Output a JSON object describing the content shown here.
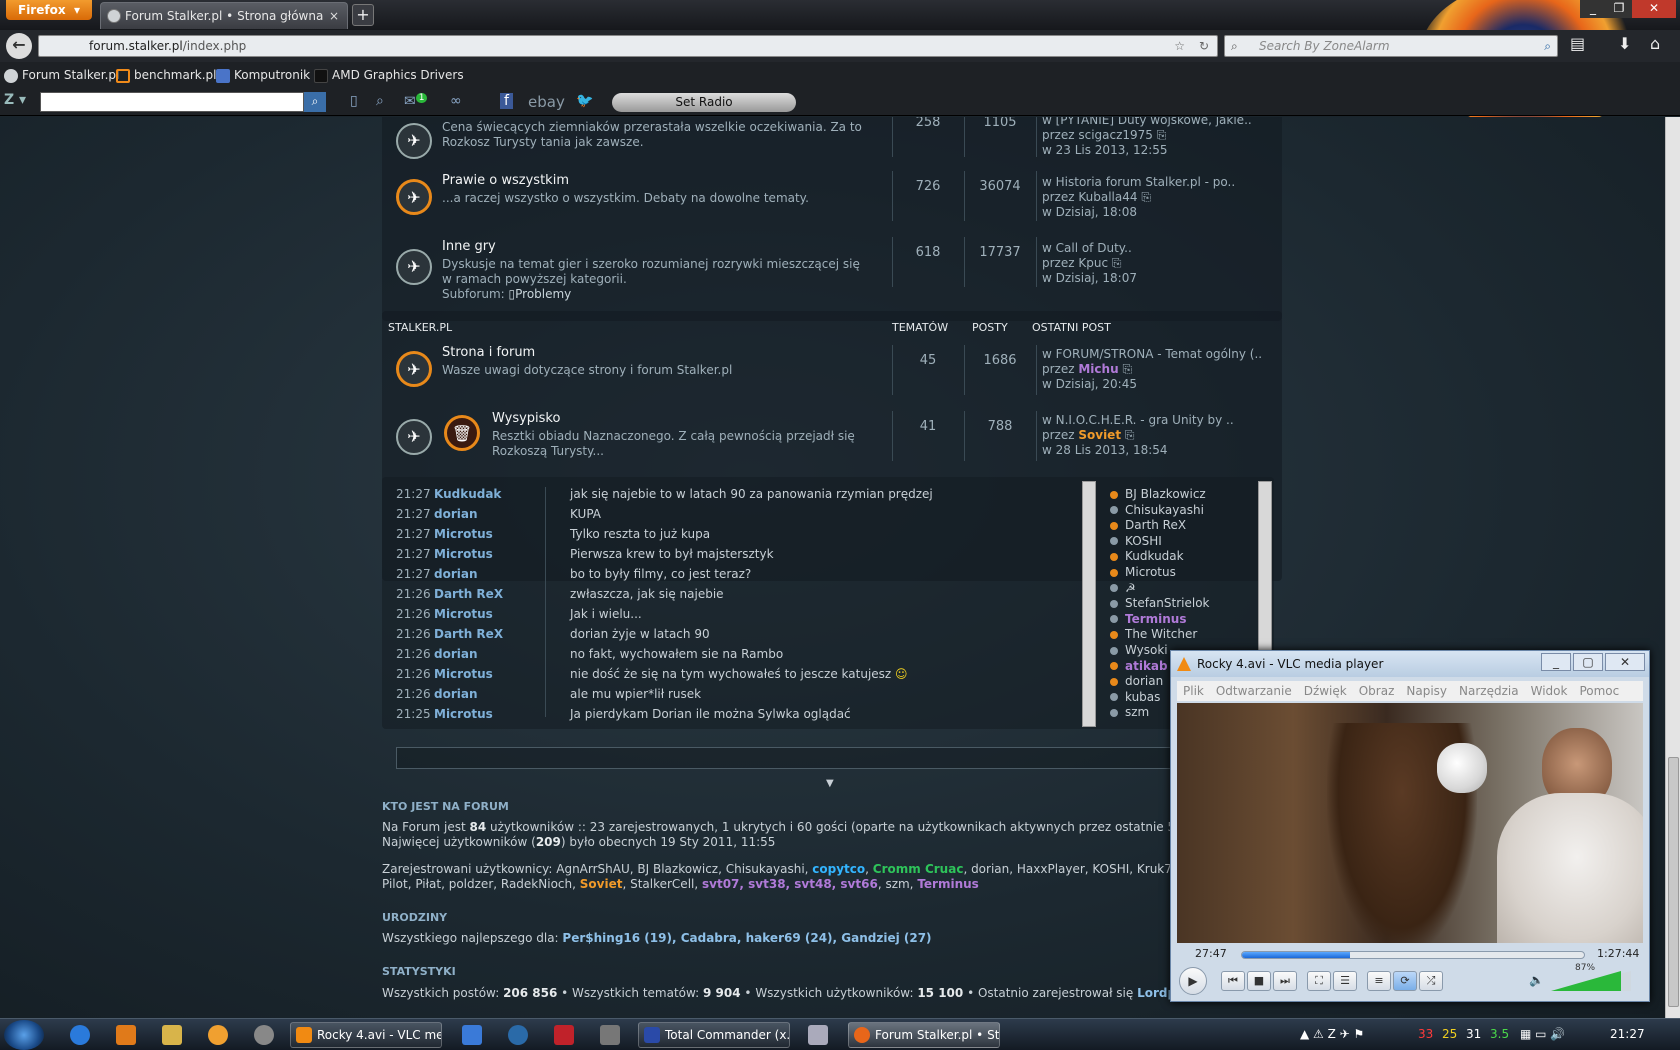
{
  "browser": {
    "menu_label": "Firefox",
    "tab_title": "Forum Stalker.pl • Strona główna",
    "url_domain": "forum.stalker.pl",
    "url_path": "/index.php",
    "search_placeholder": "Search By ZoneAlarm",
    "bookmarks": [
      "Forum Stalker.pl",
      "benchmark.pl",
      "Komputronik",
      "AMD Graphics Drivers"
    ],
    "toolbar_badge": "1",
    "toolbar_links": [
      "ebay"
    ],
    "radio_label": "Set Radio"
  },
  "forum": {
    "top_rows": [
      {
        "name": "",
        "desc": "Cena świecących ziemniaków przerastała wszelkie oczekiwania. Za to Rozkosz Turysty tania jak zawsze.",
        "topics": "258",
        "posts": "1105",
        "last_in": "w [PYTANIE] Duty wojskowe, jakie..",
        "last_by": "przez scigacz1975",
        "last_date": "w 23 Lis 2013, 12:55"
      },
      {
        "name": "Prawie o wszystkim",
        "desc": "...a raczej wszystko o wszystkim. Debaty na dowolne tematy.",
        "topics": "726",
        "posts": "36074",
        "last_in": "w Historia forum Stalker.pl - po..",
        "last_by": "przez Kuballa44",
        "last_date": "w Dzisiaj, 18:08"
      },
      {
        "name": "Inne gry",
        "desc": "Dyskusje na temat gier i szeroko rozumianej rozrywki mieszczącej się w ramach powyższej kategorii.",
        "sub_label": "Subforum:",
        "sub_link": "Problemy",
        "topics": "618",
        "posts": "17737",
        "last_in": "w Call of Duty..",
        "last_by": "przez Kpuc",
        "last_date": "w Dzisiaj, 18:07"
      }
    ],
    "category": {
      "title": "STALKER.PL",
      "col_topics": "TEMATÓW",
      "col_posts": "POSTY",
      "col_last": "OSTATNI POST"
    },
    "cat_rows": [
      {
        "name": "Strona i forum",
        "desc": "Wasze uwagi dotyczące strony i forum Stalker.pl",
        "topics": "45",
        "posts": "1686",
        "last_in": "w FORUM/STRONA - Temat ogólny (..",
        "last_by_prefix": "przez",
        "last_by": "Michu",
        "last_date": "w Dzisiaj, 20:45"
      },
      {
        "name": "Wysypisko",
        "desc": "Resztki obiadu Naznaczonego. Z całą pewnością przejadł się Rozkoszą Turysty...",
        "topics": "41",
        "posts": "788",
        "last_in": "w N.I.O.C.H.E.R. - gra Unity by ..",
        "last_by_prefix": "przez",
        "last_by": "Soviet",
        "last_date": "w 28 Lis 2013, 18:54"
      }
    ]
  },
  "chat": {
    "messages": [
      {
        "time": "21:27",
        "user": "Kudkudak",
        "text": "jak się najebie to w latach 90 za panowania rzymian prędzej"
      },
      {
        "time": "21:27",
        "user": "dorian",
        "text": "KUPA"
      },
      {
        "time": "21:27",
        "user": "Microtus",
        "text": "Tylko reszta to już kupa"
      },
      {
        "time": "21:27",
        "user": "Microtus",
        "text": "Pierwsza krew to był majstersztyk"
      },
      {
        "time": "21:27",
        "user": "dorian",
        "text": "bo to były filmy, co jest teraz?"
      },
      {
        "time": "21:26",
        "user": "Darth ReX",
        "text": "zwłaszcza, jak się najebie"
      },
      {
        "time": "21:26",
        "user": "Microtus",
        "text": "Jak i wielu..."
      },
      {
        "time": "21:26",
        "user": "Darth ReX",
        "text": "dorian żyje w latach 90"
      },
      {
        "time": "21:26",
        "user": "dorian",
        "text": "no fakt, wychowałem sie na Rambo"
      },
      {
        "time": "21:26",
        "user": "Microtus",
        "text": "nie dość że się na tym wychowałeś to jescze katujesz"
      },
      {
        "time": "21:26",
        "user": "dorian",
        "text": "ale mu wpier*lił rusek"
      },
      {
        "time": "21:25",
        "user": "Microtus",
        "text": "Ja pierdykam Dorian ile można Sylwka oglądać"
      }
    ],
    "online": [
      {
        "name": "BJ Blazkowicz",
        "color": "#e8891a",
        "cls": ""
      },
      {
        "name": "Chisukayashi",
        "color": "#8a9aa6",
        "cls": ""
      },
      {
        "name": "Darth ReX",
        "color": "#e8891a",
        "cls": ""
      },
      {
        "name": "KOSHI",
        "color": "#8a9aa6",
        "cls": ""
      },
      {
        "name": "Kudkudak",
        "color": "#e8891a",
        "cls": ""
      },
      {
        "name": "Microtus",
        "color": "#e8891a",
        "cls": ""
      },
      {
        "name": "☭",
        "color": "#8a9aa6",
        "cls": ""
      },
      {
        "name": "StefanStrielok",
        "color": "#8a9aa6",
        "cls": ""
      },
      {
        "name": "Terminus",
        "color": "#8a9aa6",
        "cls": "c-purple"
      },
      {
        "name": "The Witcher",
        "color": "#e8891a",
        "cls": ""
      },
      {
        "name": "Wysoki",
        "color": "#8a9aa6",
        "cls": ""
      },
      {
        "name": "atikab",
        "color": "#e8891a",
        "cls": "c-purple"
      },
      {
        "name": "dorian",
        "color": "#e8891a",
        "cls": ""
      },
      {
        "name": "kubas",
        "color": "#8a9aa6",
        "cls": ""
      },
      {
        "name": "szm",
        "color": "#8a9aa6",
        "cls": ""
      }
    ]
  },
  "who": {
    "title": "KTO JEST NA FORUM",
    "line1_a": "Na Forum jest ",
    "line1_b": "84",
    "line1_c": " użytkowników :: 23 zarejestrowanych, 1 ukrytych i 60 gości (oparte na użytkownikach aktywnych przez ostatnie 5 min",
    "line2_a": "Najwięcej użytkowników (",
    "line2_b": "209",
    "line2_c": ") było obecnych 19 Sty 2011, 11:55",
    "reg_label": "Zarejestrowani użytkownicy: ",
    "reg1": "AgnArrShAU, BJ Blazkowicz, Chisukayashi, ",
    "reg_copytco": "copytco",
    "reg_sep1": ", ",
    "reg_cromm": "Cromm Cruac",
    "reg2": ", dorian, HaxxPlayer, KOSHI, Kruk787,",
    "reg3": "Pilot, Piłat, poldzer, RadekNioch, ",
    "reg_soviet": "Soviet",
    "reg4": ", StalkerCell, ",
    "reg_svt": "svt07, svt38, svt48, svt66",
    "reg5": ", szm, ",
    "reg_terminus": "Terminus"
  },
  "birthdays": {
    "title": "URODZINY",
    "prefix": "Wszystkiego najlepszego dla: ",
    "list": "Per$hing16 (19), Cadabra, haker69 (24), Gandziej (27)"
  },
  "stats": {
    "title": "STATYSTYKI",
    "t1": "Wszystkich postów: ",
    "v1": "206 856",
    "t2": " • Wszystkich tematów: ",
    "v2": "9 904",
    "t3": " • Wszystkich użytkowników: ",
    "v3": "15 100",
    "t4": " • Ostatnio zarejestrował się ",
    "v4": "Lordpw"
  },
  "vlc": {
    "title": "Rocky 4.avi - VLC media player",
    "menu": [
      "Plik",
      "Odtwarzanie",
      "Dźwięk",
      "Obraz",
      "Napisy",
      "Narzędzia",
      "Widok",
      "Pomoc"
    ],
    "elapsed": "27:47",
    "total": "1:27:44",
    "progress": 0.317,
    "volume_label": "87%",
    "volume": 0.87
  },
  "taskbar": {
    "buttons": [
      "Rocky 4.avi - VLC me...",
      "Total Commander (x...",
      "Forum Stalker.pl • Str..."
    ],
    "tray_numbers": [
      "33",
      "25",
      "31",
      "3.5"
    ],
    "clock": "21:27"
  }
}
